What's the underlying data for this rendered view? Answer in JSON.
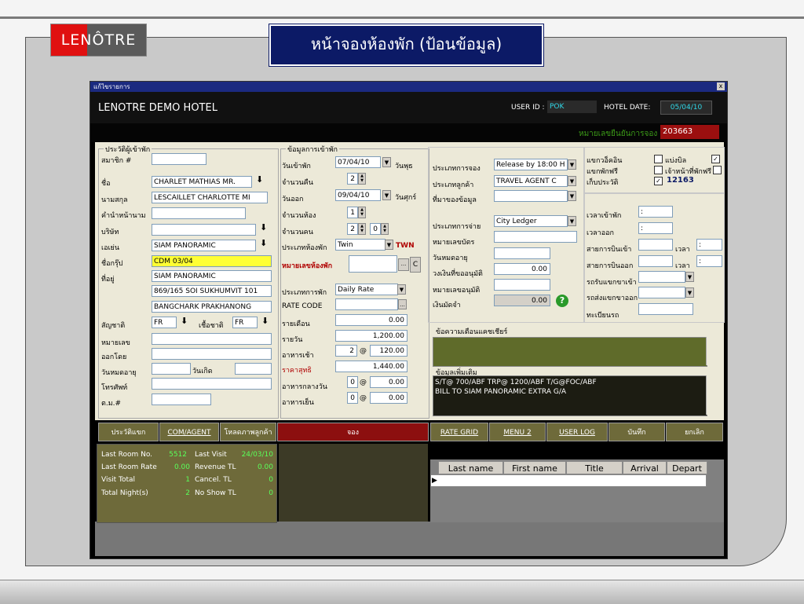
{
  "slide": {
    "logo_text": "LENÔTRE",
    "title": "หน้าจองห้องพัก (ป้อนข้อมูล)"
  },
  "window": {
    "title": "แก้ไขรายการ",
    "close": "x",
    "hotel_name": "LENOTRE DEMO HOTEL",
    "user_id_label": "USER ID :",
    "user_id": "POK",
    "hotel_date_label": "HOTEL DATE:",
    "hotel_date": "05/04/10",
    "confirm_label": "หมายเลขยืนยันการจอง",
    "confirm_no": "203663"
  },
  "guest": {
    "group_title": "ประวัติผู้เข้าพัก",
    "member_label": "สมาชิก #",
    "member": "",
    "firstname_label": "ชื่อ",
    "firstname": "CHARLET MATHIAS MR.",
    "lastname_label": "นามสกุล",
    "lastname": "LESCAILLET CHARLOTTE MI",
    "prefix_label": "คำนำหน้านาม",
    "prefix": "",
    "company_label": "บริษัท",
    "company": "",
    "agent_label": "เอเย่น",
    "agent": "SIAM PANORAMIC",
    "group_label": "ชื่อกรุ๊ป",
    "group": "CDM 03/04",
    "address_label": "ที่อยู่",
    "address1": "SIAM PANORAMIC",
    "address2": "869/165 SOI SUKHUMVIT 101",
    "address3": "BANGCHARK PRAKHANONG",
    "nationality_label": "สัญชาติ",
    "nationality": "FR",
    "race_label": "เชื้อชาติ",
    "race": "FR",
    "id_label": "หมายเลข",
    "id_no": "",
    "issued_label": "ออกโดย",
    "issued_by": "",
    "expiry_label": "วันหมดอายุ",
    "birthday_label": "วันเกิด",
    "phone_label": "โทรศัพท์",
    "taxid_label": "ต.ม.#"
  },
  "stay": {
    "group_title": "ข้อมูลการเข้าพัก",
    "checkin_label": "วันเข้าพัก",
    "checkin": "07/04/10",
    "checkin_day": "วันพุธ",
    "nights_label": "จำนวนคืน",
    "nights": "2",
    "checkout_label": "วันออก",
    "checkout": "09/04/10",
    "checkout_day": "วันศุกร์",
    "rooms_label": "จำนวนห้อง",
    "rooms": "1",
    "persons_label": "จำนวนคน",
    "adults": "2",
    "children": "0",
    "roomtype_label": "ประเภทห้องพัก",
    "roomtype": "Twin",
    "roomtype_code": "TWN",
    "roomno_label": "หมายเลขห้องพัก",
    "c_button": "C",
    "ratetype_label": "ประเภทการพัก",
    "ratetype": "Daily Rate",
    "ratecode_label": "RATE CODE",
    "monthly_label": "รายเดือน",
    "monthly": "0.00",
    "daily_label": "รายวัน",
    "daily": "1,200.00",
    "breakfast_label": "อาหารเช้า",
    "breakfast_qty": "2",
    "breakfast_price": "120.00",
    "net_label": "ราคาสุทธิ",
    "net": "1,440.00",
    "lunch_label": "อาหารกลางวัน",
    "lunch_qty": "0",
    "lunch_price": "0.00",
    "dinner_label": "อาหารเย็น",
    "dinner_qty": "0",
    "dinner_price": "0.00",
    "at": "@"
  },
  "booking": {
    "booktype_label": "ประเภทการจอง",
    "booktype": "Release by 18:00 H",
    "custtype_label": "ประเภทลูกค้า",
    "custtype": "TRAVEL AGENT C",
    "source_label": "ที่มาของข้อมูล",
    "source": "",
    "paytype_label": "ประเภทการจ่าย",
    "paytype": "City Ledger",
    "card_label": "หมายเลขบัตร",
    "expire_label": "วันหมดอายุ",
    "limit_label": "วงเงินที่ขออนุมัติ",
    "limit": "0.00",
    "approve_label": "หมายเลขอนุมัติ",
    "deposit_label": "เงินมัดจำ",
    "deposit": "0.00",
    "help_icon": "?"
  },
  "options": {
    "walkin_label": "แขกวอ็คอิน",
    "splitbill_label": "แบ่งบิล",
    "splitbill_checked": "✓",
    "comp_label": "แขกพักฟรี",
    "staff_label": "เจ้าหน้าที่พักฟรี",
    "history_label": "เก็บประวัติ",
    "history_checked": "✓",
    "history_no": "12163",
    "arrival_time_label": "เวลาเข้าพัก",
    "arrival_time": ":",
    "depart_time_label": "เวลาออก",
    "depart_time": ":",
    "flight_in_label": "สายการบินเข้า",
    "flight_out_label": "สายการบินออก",
    "time_label": "เวลา",
    "time_in": ":",
    "time_out": ":",
    "pickup_label": "รถรับแขกขาเข้า",
    "dropoff_label": "รถส่งแขกขาออก",
    "plate_label": "ทะเบียนรถ"
  },
  "notes": {
    "cashier_label": "ข้อความเตือนแคชเชียร์",
    "extra_label": "ข้อมูลเพิ่มเติม",
    "extra_line1": "S/T@ 700/ABF  TRP@ 1200/ABF  T/G@FOC/ABF",
    "extra_line2": "BILL TO SIAM PANORAMIC  EXTRA G/A"
  },
  "toolbar": {
    "b1": "ประวัติแขก",
    "b2": "COM/AGENT",
    "b3": "โหลดภาพลูกค้า",
    "b4": "จอง",
    "b5": "RATE GRID",
    "b6": "MENU 2",
    "b7": "USER LOG",
    "b8": "บันทึก",
    "b9": "ยกเลิก"
  },
  "stats": {
    "last_room_no_label": "Last Room No.",
    "last_room_no": "5512",
    "last_visit_label": "Last Visit",
    "last_visit": "24/03/10",
    "last_room_rate_label": "Last Room Rate",
    "last_room_rate": "0.00",
    "revenue_label": "Revenue TL",
    "revenue": "0.00",
    "visit_total_label": "Visit Total",
    "visit_total": "1",
    "cancel_label": "Cancel.  TL",
    "cancel": "0",
    "total_nights_label": "Total Night(s)",
    "total_nights": "2",
    "noshow_label": "No Show TL",
    "noshow": "0"
  },
  "grid": {
    "columns": [
      "Last name",
      "First name",
      "Title",
      "Arrival",
      "Depart"
    ]
  }
}
